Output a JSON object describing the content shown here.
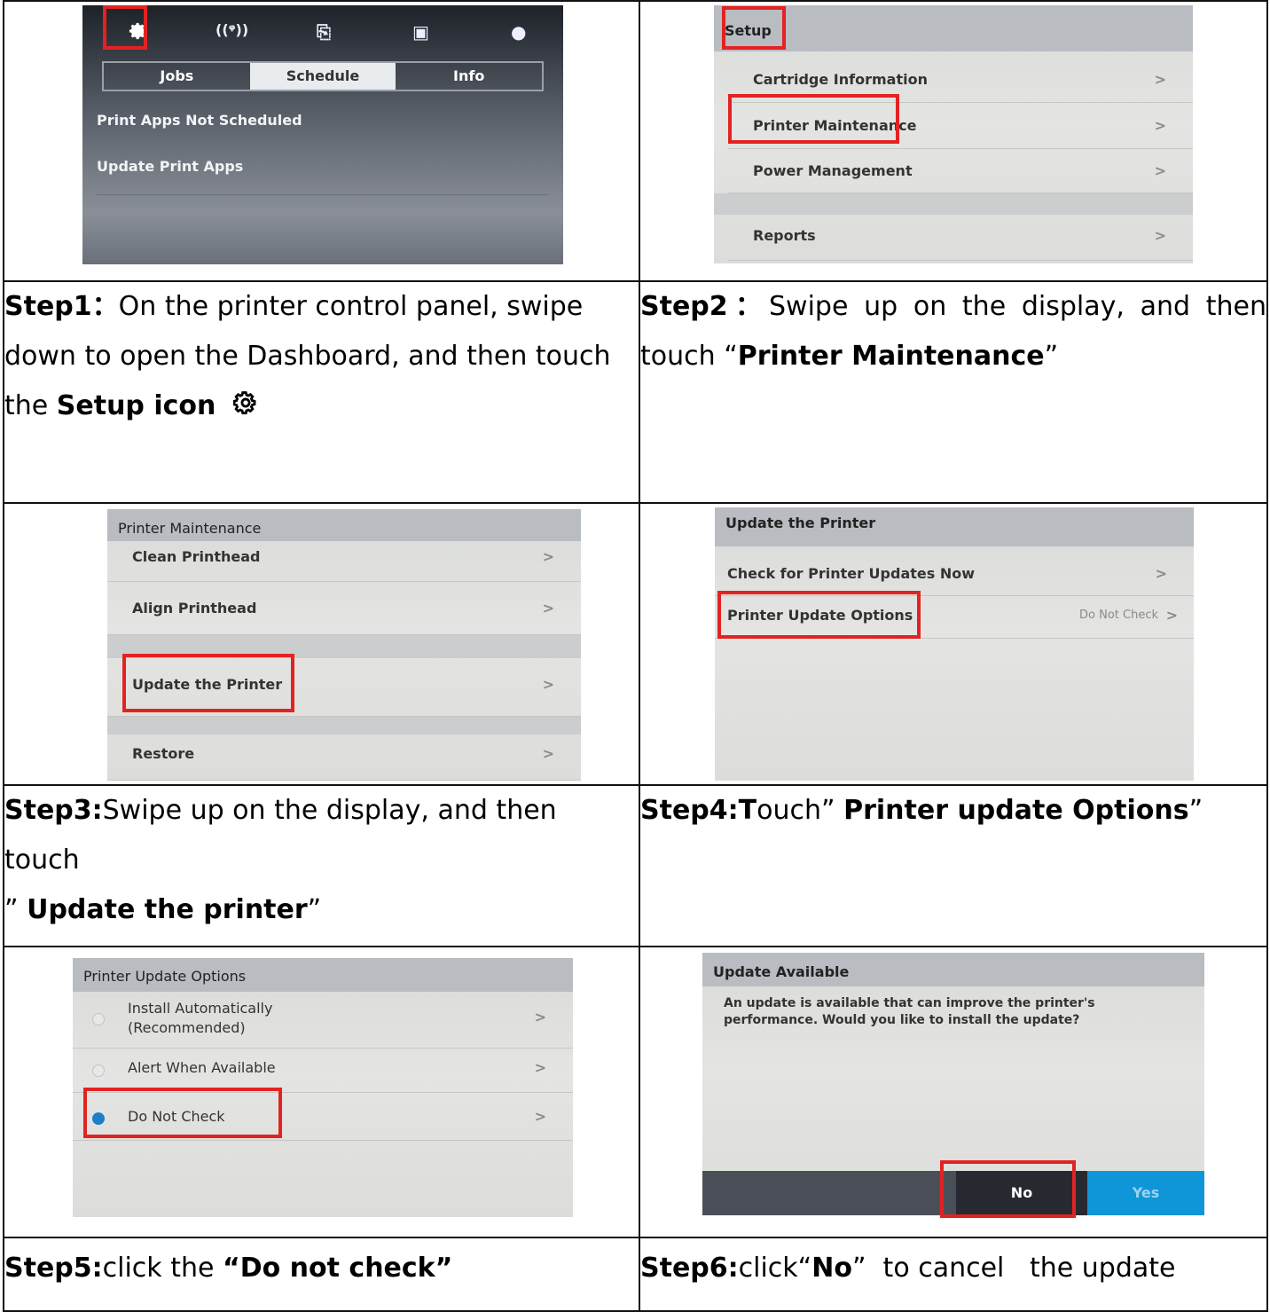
{
  "step1": {
    "screen": {
      "icons": [
        "gear-icon",
        "wireless-icon",
        "copy-icon",
        "network-icon",
        "ink-drop-icon"
      ],
      "tabs": [
        "Jobs",
        "Schedule",
        "Info"
      ],
      "rows": [
        "Print Apps Not Scheduled",
        "Update Print Apps"
      ]
    },
    "label": "Step1",
    "sep": "：",
    "text": "On the printer control panel, swipe down to open the Dashboard, and then touch the ",
    "bold_end": "Setup icon"
  },
  "step2": {
    "screen": {
      "header": "Setup",
      "rows": [
        "Cartridge Information",
        "Printer Maintenance",
        "Power Management",
        "Reports"
      ]
    },
    "label": "Step2",
    "sep": "：",
    "text": "Swipe up on the display, and then touch ",
    "bold_end": "Printer Maintenance",
    "open_quote": "“",
    "close_quote": "”"
  },
  "step3": {
    "screen": {
      "header": "Printer Maintenance",
      "rows": [
        "Clean Printhead",
        "Align Printhead",
        "Update the Printer",
        "Restore"
      ]
    },
    "label": "Step3:",
    "text": "Swipe up on the display, and then touch",
    "open_quote": "”",
    "bold_end": "Update the printer",
    "close_quote": "”"
  },
  "step4": {
    "screen": {
      "header": "Update the Printer",
      "rows": [
        "Check for Printer Updates Now",
        "Printer Update Options"
      ],
      "option_value": "Do Not Check"
    },
    "label": "Step4:T",
    "text": "ouch",
    "open_quote": "”",
    "bold_end": "Printer update Options",
    "close_quote": "”"
  },
  "step5": {
    "screen": {
      "header": "Printer Update Options",
      "options": [
        "Install Automatically",
        "(Recommended)",
        "Alert When Available",
        "Do Not Check"
      ],
      "selected": 2
    },
    "label": "Step5:",
    "text": "click the ",
    "bold_end": "“Do not check”"
  },
  "step6": {
    "screen": {
      "header": "Update Available",
      "message_line1": "An update is available that can improve the printer's",
      "message_line2": "performance. Would you like to install the update?",
      "no": "No",
      "yes": "Yes"
    },
    "label": "Step6:",
    "text": "click",
    "open_quote": "“",
    "bold_end": "No",
    "close_quote": "”",
    "text_end": "  to cancel   the update"
  },
  "chevron": ">",
  "colors": {
    "highlight": "#e32222",
    "selected_radio": "#1f7fc6",
    "yes_button": "#0f96d8"
  }
}
